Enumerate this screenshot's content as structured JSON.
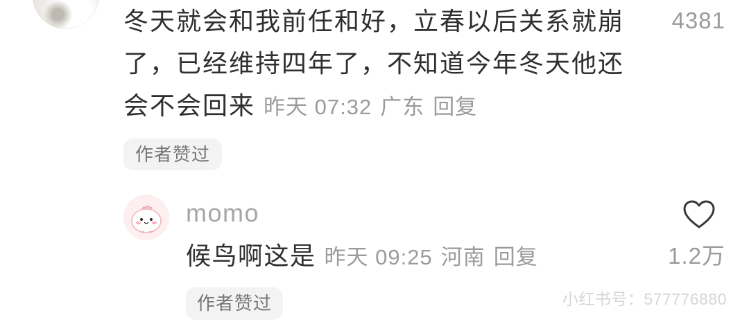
{
  "parent_comment": {
    "text": "冬天就会和我前任和好，立春以后关系就崩了，已经维持四年了，不知道今年冬天他还会不会回来",
    "time": "昨天 07:32",
    "location": "广东",
    "reply_label": "回复",
    "like_count": "4381",
    "author_liked_badge": "作者赞过"
  },
  "reply": {
    "username": "momo",
    "text": "候鸟啊这是",
    "time": "昨天 09:25",
    "location": "河南",
    "reply_label": "回复",
    "like_count": "1.2万",
    "author_liked_badge": "作者赞过"
  },
  "watermark": "小红书号：577776880",
  "icons": {
    "like": "heart-outline-icon"
  },
  "theme": {
    "text_color": "#2f2f2f",
    "meta_color": "#9b9b9b",
    "badge_background": "#f3f3f3",
    "badge_text_color": "#767676",
    "watermark_color": "#d6d6d6",
    "icon_color": "#3a3a3a"
  }
}
